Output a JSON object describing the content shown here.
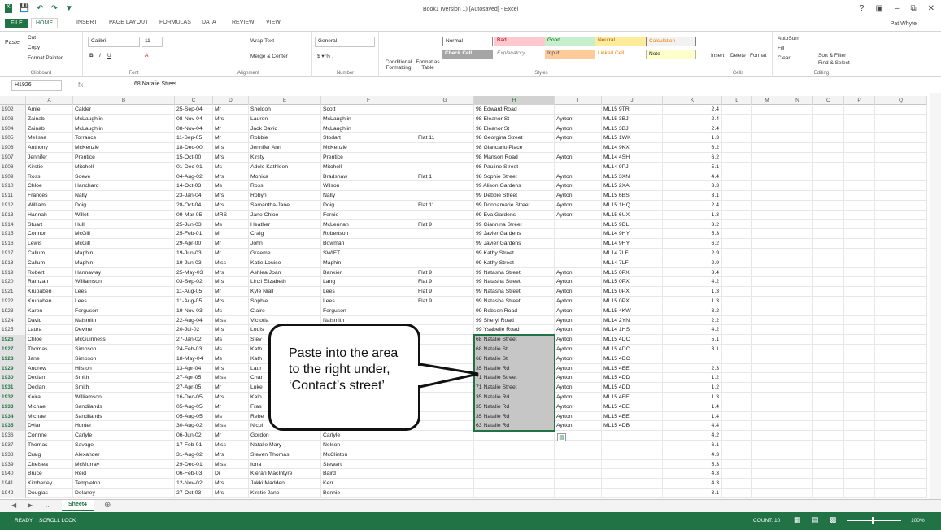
{
  "titlebar": {
    "title": "Book1 (version 1) [Autosaved] - Excel",
    "user": "Pat Whyte",
    "controls": [
      "?",
      "⊡",
      "–",
      "⧉",
      "✕"
    ]
  },
  "tabs": [
    "FILE",
    "HOME",
    "INSERT",
    "PAGE LAYOUT",
    "FORMULAS",
    "DATA",
    "REVIEW",
    "VIEW"
  ],
  "ribbon": {
    "clipboard": {
      "cut": "Cut",
      "copy": "Copy",
      "paste": "Paste",
      "format_painter": "Format Painter",
      "label": "Clipboard"
    },
    "font": {
      "name": "Calibri",
      "size": "11",
      "label": "Font"
    },
    "alignment": {
      "wrap": "Wrap Text",
      "merge": "Merge & Center",
      "label": "Alignment"
    },
    "number": {
      "format": "General",
      "label": "Number"
    },
    "cond": {
      "conditional": "Conditional Formatting",
      "format_table": "Format as Table"
    },
    "styles": {
      "normal": "Normal",
      "bad": "Bad",
      "good": "Good",
      "neutral": "Neutral",
      "calculation": "Calculation",
      "check_cell": "Check Cell",
      "explanatory": "Explanatory ...",
      "input": "Input",
      "linked_cell": "Linked Cell",
      "note": "Note",
      "label": "Styles"
    },
    "cells": {
      "insert": "Insert",
      "delete": "Delete",
      "format": "Format",
      "label": "Cells"
    },
    "editing": {
      "autosum": "AutoSum",
      "fill": "Fill",
      "clear": "Clear",
      "sort": "Sort & Filter",
      "find": "Find & Select",
      "label": "Editing"
    }
  },
  "formula_bar": {
    "name_box": "H1926",
    "fx": "fx",
    "value": "68 Natalie Street"
  },
  "columns": [
    "A",
    "B",
    "C",
    "D",
    "E",
    "F",
    "G",
    "H",
    "I",
    "J",
    "K",
    "L",
    "M",
    "N",
    "O",
    "P",
    "Q"
  ],
  "rows": [
    {
      "n": "1902",
      "a": "Amie",
      "b": "Calder",
      "c": "25-Sep-04",
      "d": "Mr",
      "e": "Sheldon",
      "f": "Scott",
      "g": "",
      "h": "98 Edward Road",
      "i": "",
      "j": "ML15 9TR",
      "k": "2.4"
    },
    {
      "n": "1903",
      "a": "Zainab",
      "b": "McLaughlin",
      "c": "08-Nov-04",
      "d": "Mrs",
      "e": "Lauren",
      "f": "McLaughlin",
      "g": "",
      "h": "98 Eleanor St",
      "i": "Ayrton",
      "j": "ML15 3BJ",
      "k": "2.4"
    },
    {
      "n": "1904",
      "a": "Zainab",
      "b": "McLaughlin",
      "c": "08-Nov-04",
      "d": "Mr",
      "e": "Jack David",
      "f": "McLaughlin",
      "g": "",
      "h": "98 Eleanor St",
      "i": "Ayrton",
      "j": "ML15 3BJ",
      "k": "2.4"
    },
    {
      "n": "1905",
      "a": "Melissa",
      "b": "Torrance",
      "c": "11-Sep-05",
      "d": "Mr",
      "e": "Robbie",
      "f": "Stodart",
      "g": "Flat 11",
      "h": "98 Georgina Street",
      "i": "Ayrton",
      "j": "ML15 1WK",
      "k": "1.3"
    },
    {
      "n": "1906",
      "a": "Anthony",
      "b": "McKenzie",
      "c": "18-Dec-00",
      "d": "Mrs",
      "e": "Jennifer Ann",
      "f": "McKenzie",
      "g": "",
      "h": "98 Giancarlo Place",
      "i": "",
      "j": "ML14 9KX",
      "k": "6.2"
    },
    {
      "n": "1907",
      "a": "Jennifer",
      "b": "Prentice",
      "c": "15-Oct-00",
      "d": "Mrs",
      "e": "Kirsty",
      "f": "Prentice",
      "g": "",
      "h": "98 Manson Road",
      "i": "Ayrton",
      "j": "ML14 4SH",
      "k": "6.2"
    },
    {
      "n": "1908",
      "a": "Kirstie",
      "b": "Mitchell",
      "c": "01-Dec-01",
      "d": "Ms",
      "e": "Adele Kathleen",
      "f": "Mitchell",
      "g": "",
      "h": "98 Pauline Street",
      "i": "",
      "j": "ML14 9PJ",
      "k": "5.1"
    },
    {
      "n": "1909",
      "a": "Ross",
      "b": "Soeve",
      "c": "04-Aug-02",
      "d": "Mrs",
      "e": "Monica",
      "f": "Bradshaw",
      "g": "Flat 1",
      "h": "98 Sophie Street",
      "i": "Ayrton",
      "j": "ML15 3XN",
      "k": "4.4"
    },
    {
      "n": "1910",
      "a": "Chloe",
      "b": "Hanchard",
      "c": "14-Oct-03",
      "d": "Ms",
      "e": "Ross",
      "f": "Wilson",
      "g": "",
      "h": "99 Alison Gardens",
      "i": "Ayrton",
      "j": "ML15 2XA",
      "k": "3.3"
    },
    {
      "n": "1911",
      "a": "Frances",
      "b": "Nally",
      "c": "23-Jan-04",
      "d": "Mrs",
      "e": "Robyn",
      "f": "Nally",
      "g": "",
      "h": "99 Debbie Street",
      "i": "Ayrton",
      "j": "ML15 6BS",
      "k": "3.1"
    },
    {
      "n": "1912",
      "a": "William",
      "b": "Doig",
      "c": "28-Oct-04",
      "d": "Mrs",
      "e": "Samantha-Jane",
      "f": "Doig",
      "g": "Flat 11",
      "h": "99 Donnamarie Street",
      "i": "Ayrton",
      "j": "ML15 1HQ",
      "k": "2.4"
    },
    {
      "n": "1913",
      "a": "Hannah",
      "b": "Willet",
      "c": "09-Mar-05",
      "d": "MRS",
      "e": "Jane Chloe",
      "f": "Fernie",
      "g": "",
      "h": "99 Eva Gardens",
      "i": "Ayrton",
      "j": "ML15 6UX",
      "k": "1.3"
    },
    {
      "n": "1914",
      "a": "Stuart",
      "b": "Hull",
      "c": "25-Jun-03",
      "d": "Ms",
      "e": "Heather",
      "f": "McLennan",
      "g": "Flat 9",
      "h": "99 Giannina Street",
      "i": "",
      "j": "ML15 9DL",
      "k": "3.2"
    },
    {
      "n": "1915",
      "a": "Connor",
      "b": "McGill",
      "c": "25-Feb-01",
      "d": "Mr",
      "e": "Craig",
      "f": "Robertson",
      "g": "",
      "h": "99 Javier Gardens",
      "i": "",
      "j": "ML14 9HY",
      "k": "5.3"
    },
    {
      "n": "1916",
      "a": "Lewis",
      "b": "McGill",
      "c": "29-Apr-00",
      "d": "Mr",
      "e": "John",
      "f": "Bowman",
      "g": "",
      "h": "99 Javier Gardens",
      "i": "",
      "j": "ML14 9HY",
      "k": "6.2"
    },
    {
      "n": "1917",
      "a": "Callum",
      "b": "Maphin",
      "c": "19-Jun-03",
      "d": "Mr",
      "e": "Graeme",
      "f": "SWIFT",
      "g": "",
      "h": "99 Kathy Street",
      "i": "",
      "j": "ML14 7LF",
      "k": "2.9"
    },
    {
      "n": "1918",
      "a": "Callum",
      "b": "Maphin",
      "c": "19-Jun-03",
      "d": "Miss",
      "e": "Katie Louise",
      "f": "Maphin",
      "g": "",
      "h": "99 Kathy Street",
      "i": "",
      "j": "ML14 7LF",
      "k": "2.9"
    },
    {
      "n": "1919",
      "a": "Robert",
      "b": "Hannaway",
      "c": "25-May-03",
      "d": "Mrs",
      "e": "Ashlea Joan",
      "f": "Bankier",
      "g": "Flat 9",
      "h": "99 Natasha Street",
      "i": "Ayrton",
      "j": "ML15 0PX",
      "k": "3.4"
    },
    {
      "n": "1920",
      "a": "Ramzan",
      "b": "Williamson",
      "c": "03-Sep-02",
      "d": "Mrs",
      "e": "Linzi Elizabeth",
      "f": "Lang",
      "g": "Flat 9",
      "h": "99 Natasha Street",
      "i": "Ayrton",
      "j": "ML15 0PX",
      "k": "4.2"
    },
    {
      "n": "1921",
      "a": "Krupaben",
      "b": "Lees",
      "c": "11-Aug-05",
      "d": "Mr",
      "e": "Kyle Niall",
      "f": "Lees",
      "g": "Flat 9",
      "h": "99 Natasha Street",
      "i": "Ayrton",
      "j": "ML15 0PX",
      "k": "1.3"
    },
    {
      "n": "1922",
      "a": "Krupaben",
      "b": "Lees",
      "c": "11-Aug-05",
      "d": "Mrs",
      "e": "Sophie",
      "f": "Lees",
      "g": "Flat 9",
      "h": "99 Natasha Street",
      "i": "Ayrton",
      "j": "ML15 0PX",
      "k": "1.3"
    },
    {
      "n": "1923",
      "a": "Karen",
      "b": "Ferguson",
      "c": "19-Nov-03",
      "d": "Ms",
      "e": "Claire",
      "f": "Ferguson",
      "g": "",
      "h": "99 Robsen Road",
      "i": "Ayrton",
      "j": "ML15 4KW",
      "k": "3.2"
    },
    {
      "n": "1924",
      "a": "David",
      "b": "Naismith",
      "c": "22-Aug-04",
      "d": "Miss",
      "e": "Victoria",
      "f": "Naismith",
      "g": "",
      "h": "99 Sheryl Road",
      "i": "Ayrton",
      "j": "ML14 2YN",
      "k": "2.2"
    },
    {
      "n": "1925",
      "a": "Laura",
      "b": "Devine",
      "c": "20-Jul-02",
      "d": "Mrs",
      "e": "Louis",
      "f": "",
      "g": "",
      "h": "99 Ysabelle Road",
      "i": "Ayrton",
      "j": "ML14 1HS",
      "k": "4.2"
    },
    {
      "n": "1926",
      "a": "Chloe",
      "b": "McGuinness",
      "c": "27-Jan-02",
      "d": "Ms",
      "e": "Stev",
      "f": "",
      "g": "",
      "h": "68 Natalie Street",
      "i": "Ayrton",
      "j": "ML15 4DC",
      "k": "5.1",
      "sel": true
    },
    {
      "n": "1927",
      "a": "Thomas",
      "b": "Simpson",
      "c": "24-Feb-03",
      "d": "Ms",
      "e": "Kath",
      "f": "",
      "g": "",
      "h": "68 Natalie St",
      "i": "Ayrton",
      "j": "ML15 4DC",
      "k": "3.1",
      "sel": true
    },
    {
      "n": "1928",
      "a": "Jane",
      "b": "Simpson",
      "c": "18-May-04",
      "d": "Ms",
      "e": "Kath",
      "f": "",
      "g": "",
      "h": "68 Natalie St",
      "i": "Ayrton",
      "j": "ML15 4DC",
      "k": "",
      "sel": true
    },
    {
      "n": "1929",
      "a": "Andrew",
      "b": "Hilston",
      "c": "13-Apr-04",
      "d": "Mrs",
      "e": "Laur",
      "f": "",
      "g": "",
      "h": "35 Natalie Rd",
      "i": "Ayrton",
      "j": "ML15 4EE",
      "k": "2.3",
      "sel": true
    },
    {
      "n": "1930",
      "a": "Declan",
      "b": "Smith",
      "c": "27-Apr-05",
      "d": "Miss",
      "e": "Char",
      "f": "",
      "g": "",
      "h": "71 Natalie Street",
      "i": "Ayrton",
      "j": "ML15 4DD",
      "k": "1.2",
      "sel": true
    },
    {
      "n": "1931",
      "a": "Declan",
      "b": "Smith",
      "c": "27-Apr-05",
      "d": "Mr",
      "e": "Luke",
      "f": "",
      "g": "",
      "h": "71 Natalie Street",
      "i": "Ayrton",
      "j": "ML15 4DD",
      "k": "1.2",
      "sel": true
    },
    {
      "n": "1932",
      "a": "Keira",
      "b": "Williamson",
      "c": "16-Dec-05",
      "d": "Mrs",
      "e": "Kalo",
      "f": "",
      "g": "",
      "h": "35 Natalie Rd",
      "i": "Ayrton",
      "j": "ML15 4EE",
      "k": "1.3",
      "sel": true
    },
    {
      "n": "1933",
      "a": "Michael",
      "b": "Sandilands",
      "c": "05-Aug-05",
      "d": "Mr",
      "e": "Fras",
      "f": "",
      "g": "",
      "h": "35 Natalie Rd",
      "i": "Ayrton",
      "j": "ML15 4EE",
      "k": "1.4",
      "sel": true
    },
    {
      "n": "1934",
      "a": "Michael",
      "b": "Sandilands",
      "c": "05-Aug-05",
      "d": "Ms",
      "e": "Rebe",
      "f": "",
      "g": "",
      "h": "35 Natalie Rd",
      "i": "Ayrton",
      "j": "ML15 4EE",
      "k": "1.4",
      "sel": true
    },
    {
      "n": "1935",
      "a": "Dylan",
      "b": "Hunter",
      "c": "30-Aug-02",
      "d": "Miss",
      "e": "Nicol",
      "f": "",
      "g": "",
      "h": "63 Natalie Rd",
      "i": "Ayrton",
      "j": "ML15 4DB",
      "k": "4.4",
      "sel": true
    },
    {
      "n": "1936",
      "a": "Corinne",
      "b": "Carlyle",
      "c": "06-Jun-02",
      "d": "Mr",
      "e": "Gordon",
      "f": "Carlyle",
      "g": "",
      "h": "",
      "i": "",
      "j": "",
      "k": "4.2"
    },
    {
      "n": "1937",
      "a": "Thomas",
      "b": "Savage",
      "c": "17-Feb-01",
      "d": "Miss",
      "e": "Natalie Mary",
      "f": "Nelson",
      "g": "",
      "h": "",
      "i": "",
      "j": "",
      "k": "6.1"
    },
    {
      "n": "1938",
      "a": "Craig",
      "b": "Alexander",
      "c": "31-Aug-02",
      "d": "Mrs",
      "e": "Steven Thomas",
      "f": "McClinton",
      "g": "",
      "h": "",
      "i": "",
      "j": "",
      "k": "4.3"
    },
    {
      "n": "1939",
      "a": "Chelsea",
      "b": "McMurray",
      "c": "29-Dec-01",
      "d": "Miss",
      "e": "Iona",
      "f": "Stewart",
      "g": "",
      "h": "",
      "i": "",
      "j": "",
      "k": "5.3"
    },
    {
      "n": "1940",
      "a": "Bruce",
      "b": "Reid",
      "c": "06-Feb-03",
      "d": "Dr",
      "e": "Kieran MacIntyre",
      "f": "Baird",
      "g": "",
      "h": "",
      "i": "",
      "j": "",
      "k": "4.3"
    },
    {
      "n": "1941",
      "a": "Kimberley",
      "b": "Templeton",
      "c": "12-Nov-02",
      "d": "Mrs",
      "e": "Jakki Madden",
      "f": "Kerr",
      "g": "",
      "h": "",
      "i": "",
      "j": "",
      "k": "4.3"
    },
    {
      "n": "1942",
      "a": "Douglas",
      "b": "Delaney",
      "c": "27-Oct-03",
      "d": "Mrs",
      "e": "Kirstie Jane",
      "f": "Bennie",
      "g": "",
      "h": "",
      "i": "",
      "j": "",
      "k": "3.1"
    }
  ],
  "callout": {
    "text": "Paste into the area to the right under, ‘Contact’s street’"
  },
  "sheet": {
    "tab": "Sheet4",
    "more": "...",
    "add": "⊕"
  },
  "status": {
    "ready": "READY",
    "scroll": "SCROLL LOCK",
    "count": "COUNT: 10",
    "zoom": "100%"
  }
}
